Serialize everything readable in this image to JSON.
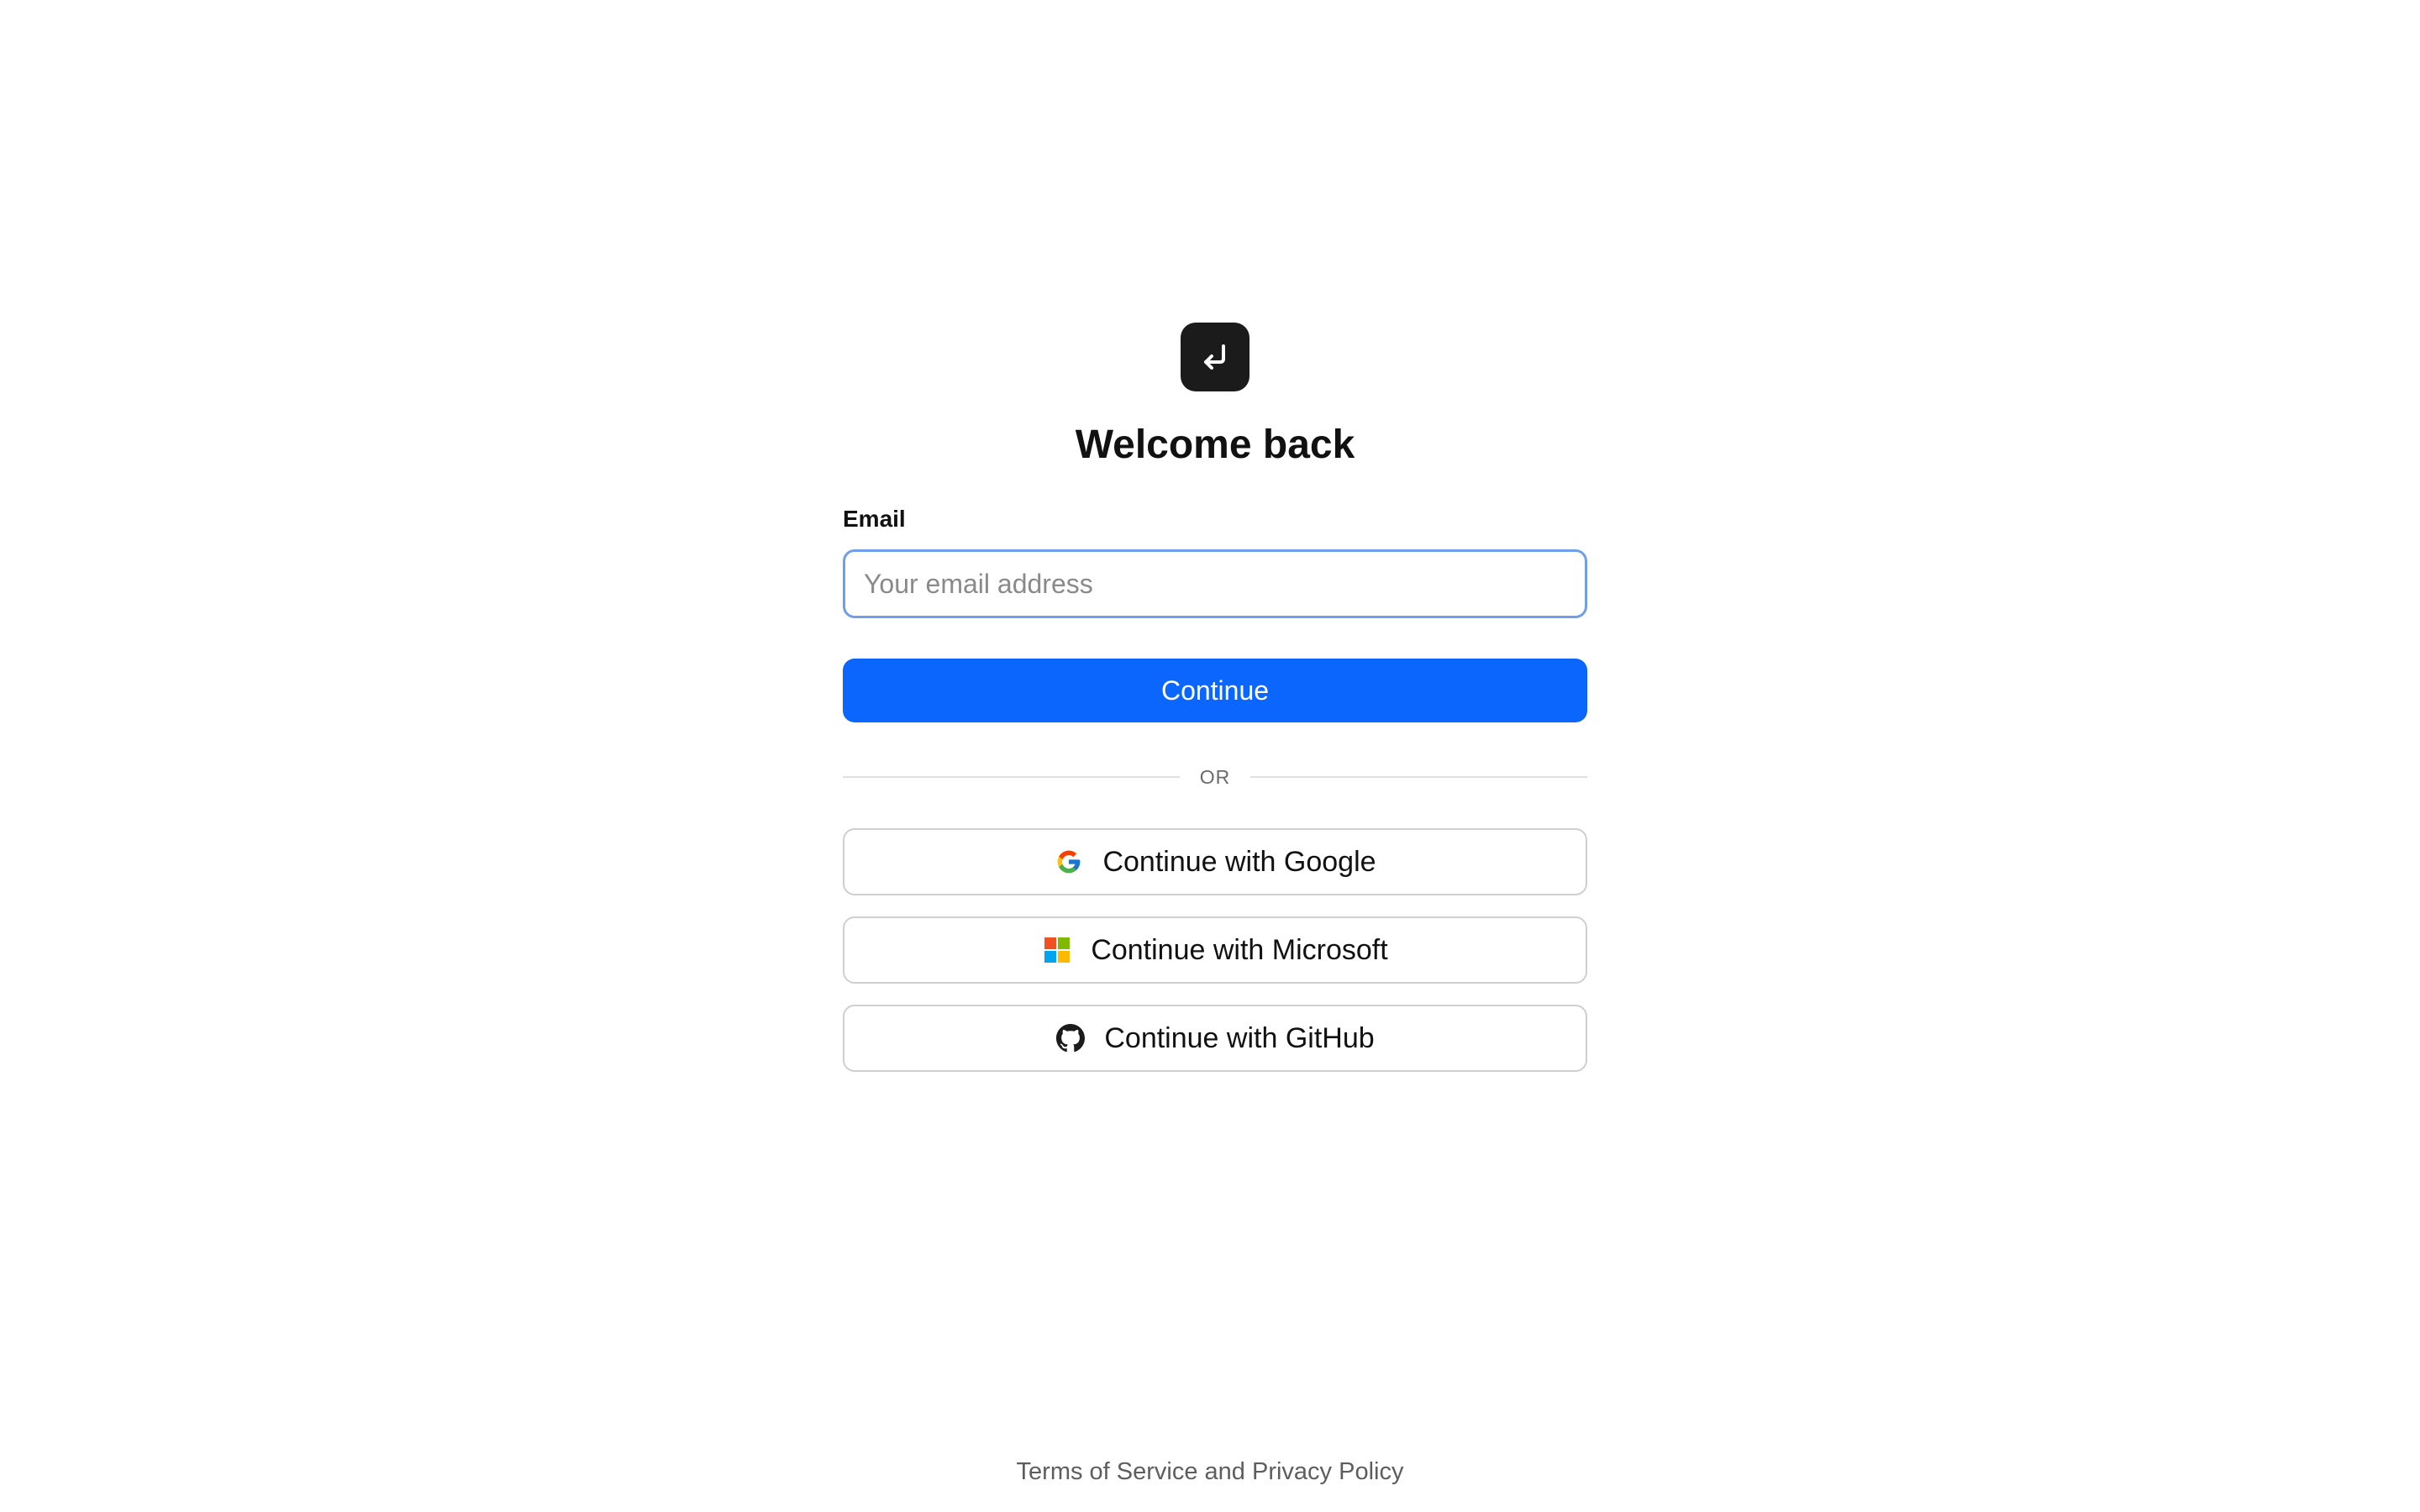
{
  "logo": {
    "icon": "return-arrow-icon",
    "background": "#1b1b1b"
  },
  "title": "Welcome back",
  "email": {
    "label": "Email",
    "value": "",
    "placeholder": "Your email address",
    "focus_color": "#6f9fea"
  },
  "continue_button": {
    "label": "Continue",
    "color": "#0b66fe"
  },
  "divider": {
    "label": "OR"
  },
  "social": [
    {
      "label": "Continue with Google",
      "icon": "google-icon"
    },
    {
      "label": "Continue with Microsoft",
      "icon": "microsoft-icon"
    },
    {
      "label": "Continue with GitHub",
      "icon": "github-icon"
    }
  ],
  "footer": {
    "text": "Terms of Service and Privacy Policy"
  }
}
